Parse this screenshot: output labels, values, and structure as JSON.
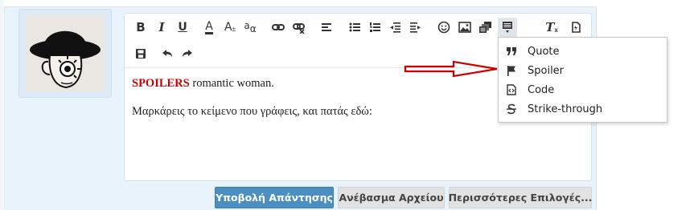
{
  "colors": {
    "accent": "#4a8ec2",
    "spoiler_text": "#cc0000",
    "arrow": "#cc0000",
    "panel_background": "#e8f3fc"
  },
  "toolbar": {
    "row1_icons": [
      "bold-icon",
      "italic-icon",
      "underline-icon",
      "text-color-icon",
      "font-size-icon",
      "font-family-icon",
      "link-icon",
      "unlink-icon",
      "align-icon",
      "bullet-list-icon",
      "numbered-list-icon",
      "outdent-icon",
      "indent-icon",
      "smilie-icon",
      "image-icon",
      "media-icon",
      "insert-menu-icon",
      "remove-formatting-icon",
      "switch-bbcode-icon"
    ],
    "row2_icons": [
      "save-draft-icon",
      "undo-icon",
      "redo-icon"
    ],
    "bold_glyph": "B",
    "italic_glyph": "I",
    "underline_glyph": "U",
    "text_color_glyph": "A",
    "font_size_glyph": "A",
    "font_size_sub": "±",
    "font_family_glyph": "a",
    "font_family_sub": "α"
  },
  "editor": {
    "line1_spoiler": "SPOILERS",
    "line1_rest": " romantic woman.",
    "line2": "Μαρκάρεις το κείμενο που γράφεις, και πατάς εδώ:"
  },
  "insert_menu": {
    "items": [
      {
        "label": "Quote",
        "icon": "quote-icon"
      },
      {
        "label": "Spoiler",
        "icon": "flag-icon"
      },
      {
        "label": "Code",
        "icon": "code-icon"
      },
      {
        "label": "Strike-through",
        "icon": "strikethrough-icon"
      }
    ]
  },
  "actions": {
    "submit_label": "Υποβολή Απάντησης",
    "upload_label": "Ανέβασμα Αρχείου",
    "more_label": "Περισσότερες Επιλογές..."
  }
}
